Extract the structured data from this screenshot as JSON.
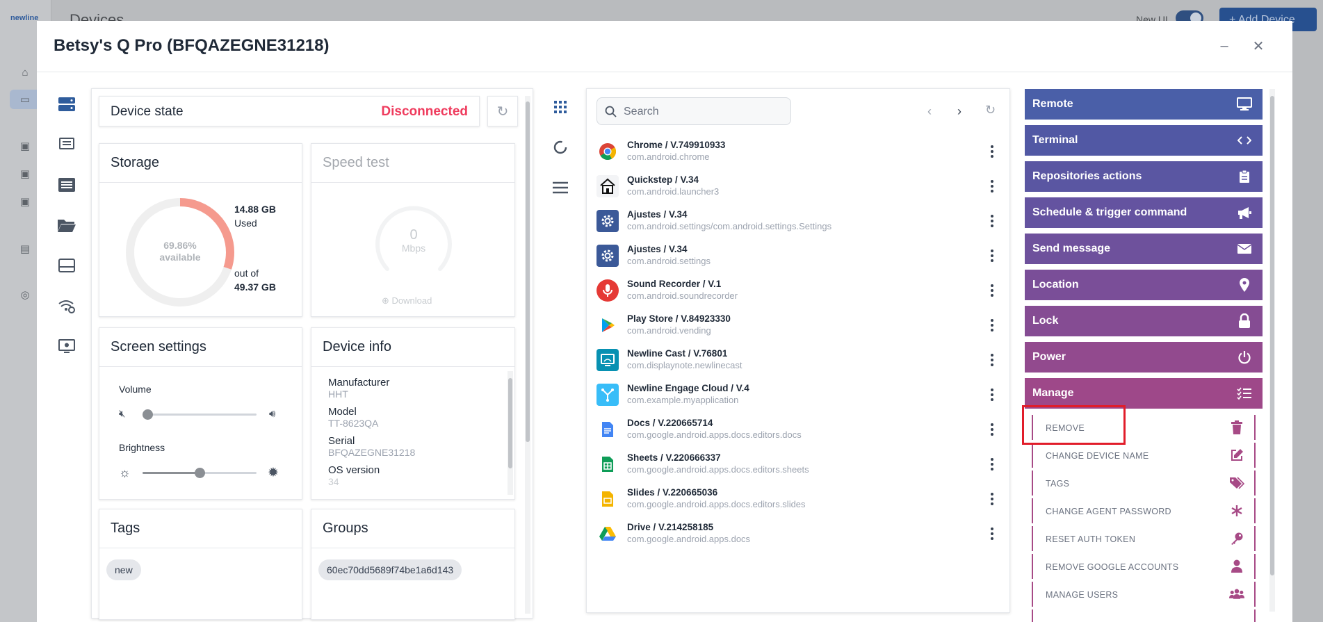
{
  "background": {
    "logo": "newline",
    "header_title": "Devices",
    "new_ui_label": "New UI",
    "add_device_label": "+ Add Device"
  },
  "modal": {
    "title": "Betsy's Q Pro (BFQAZEGNE31218)"
  },
  "device_state": {
    "label": "Device state",
    "status": "Disconnected",
    "status_color": "#ef3b5d"
  },
  "storage": {
    "title": "Storage",
    "available_percent": "69.86%",
    "available_label": "available",
    "available_fraction": 0.6986,
    "used_value": "14.88 GB",
    "used_label": "Used",
    "out_of_label": "out of",
    "total_value": "49.37 GB"
  },
  "speed_test": {
    "title": "Speed test",
    "value": "0",
    "unit": "Mbps",
    "download_label": "Download"
  },
  "screen_settings": {
    "title": "Screen settings",
    "volume_label": "Volume",
    "volume_level": 0.0,
    "brightness_label": "Brightness",
    "brightness_level": 0.5
  },
  "device_info": {
    "title": "Device info",
    "fields": [
      {
        "label": "Manufacturer",
        "value": "HHT"
      },
      {
        "label": "Model",
        "value": "TT-8623QA"
      },
      {
        "label": "Serial",
        "value": "BFQAZEGNE31218"
      },
      {
        "label": "OS version",
        "value": "34"
      }
    ]
  },
  "tags": {
    "title": "Tags",
    "items": [
      "new"
    ]
  },
  "groups": {
    "title": "Groups",
    "items": [
      "60ec70dd5689f74be1a6d143"
    ]
  },
  "apps": {
    "search_placeholder": "Search",
    "items": [
      {
        "name": "Chrome / V.749910933",
        "package": "com.android.chrome",
        "icon": "chrome-icon"
      },
      {
        "name": "Quickstep / V.34",
        "package": "com.android.launcher3",
        "icon": "home-icon"
      },
      {
        "name": "Ajustes / V.34",
        "package": "com.android.settings/com.android.settings.Settings",
        "icon": "settings-gear-icon"
      },
      {
        "name": "Ajustes / V.34",
        "package": "com.android.settings",
        "icon": "settings-gear-icon"
      },
      {
        "name": "Sound Recorder / V.1",
        "package": "com.android.soundrecorder",
        "icon": "microphone-icon"
      },
      {
        "name": "Play Store / V.84923330",
        "package": "com.android.vending",
        "icon": "play-store-icon"
      },
      {
        "name": "Newline Cast / V.76801",
        "package": "com.displaynote.newlinecast",
        "icon": "cast-icon"
      },
      {
        "name": "Newline Engage Cloud / V.4",
        "package": "com.example.myapplication",
        "icon": "engage-icon"
      },
      {
        "name": "Docs / V.220665714",
        "package": "com.google.android.apps.docs.editors.docs",
        "icon": "docs-icon"
      },
      {
        "name": "Sheets / V.220666337",
        "package": "com.google.android.apps.docs.editors.sheets",
        "icon": "sheets-icon"
      },
      {
        "name": "Slides / V.220665036",
        "package": "com.google.android.apps.docs.editors.slides",
        "icon": "slides-icon"
      },
      {
        "name": "Drive / V.214258185",
        "package": "com.google.android.apps.docs",
        "icon": "drive-icon"
      }
    ]
  },
  "actions": [
    {
      "label": "Remote",
      "icon": "monitor-icon",
      "color": "#4a5fa8"
    },
    {
      "label": "Terminal",
      "icon": "code-icon",
      "color": "#5158a4"
    },
    {
      "label": "Repositories actions",
      "icon": "clipboard-icon",
      "color": "#5a56a2"
    },
    {
      "label": "Schedule & trigger command",
      "icon": "megaphone-icon",
      "color": "#6453a0"
    },
    {
      "label": "Send message",
      "icon": "envelope-icon",
      "color": "#6e519c"
    },
    {
      "label": "Location",
      "icon": "map-pin-icon",
      "color": "#7a4e98"
    },
    {
      "label": "Lock",
      "icon": "lock-icon",
      "color": "#854c93"
    },
    {
      "label": "Power",
      "icon": "power-icon",
      "color": "#924a8e"
    },
    {
      "label": "Manage",
      "icon": "list-check-icon",
      "color": "#9e4889"
    }
  ],
  "manage_items": [
    {
      "label": "REMOVE",
      "icon": "trash-icon"
    },
    {
      "label": "CHANGE DEVICE NAME",
      "icon": "edit-icon"
    },
    {
      "label": "TAGS",
      "icon": "tags-icon"
    },
    {
      "label": "CHANGE AGENT PASSWORD",
      "icon": "asterisk-icon"
    },
    {
      "label": "RESET AUTH TOKEN",
      "icon": "key-icon"
    },
    {
      "label": "REMOVE GOOGLE ACCOUNTS",
      "icon": "user-icon"
    },
    {
      "label": "MANAGE USERS",
      "icon": "users-icon"
    }
  ],
  "colors": {
    "manage_accent": "#a74a86",
    "primary": "#305c9c",
    "storage_ring_used": "#f38f86"
  }
}
